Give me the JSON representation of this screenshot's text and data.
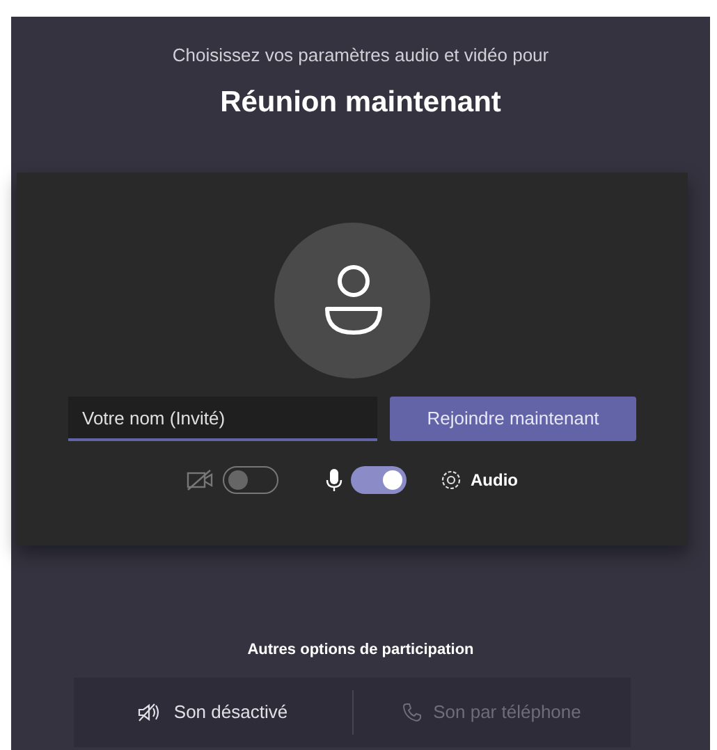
{
  "header": {
    "subtitle": "Choisissez vos paramètres audio et vidéo pour",
    "title": "Réunion maintenant"
  },
  "name_field": {
    "placeholder": "Votre nom (Invité)"
  },
  "join_button": {
    "label": "Rejoindre maintenant"
  },
  "toggles": [
    {
      "kind": "camera",
      "on": false
    },
    {
      "kind": "microphone",
      "on": true
    }
  ],
  "audio_settings": {
    "label": "Audio"
  },
  "other_options": {
    "title": "Autres options de participation",
    "items": [
      {
        "kind": "audio-off",
        "label": "Son désactivé",
        "disabled": false
      },
      {
        "kind": "phone",
        "label": "Son par téléphone",
        "disabled": true
      }
    ]
  }
}
